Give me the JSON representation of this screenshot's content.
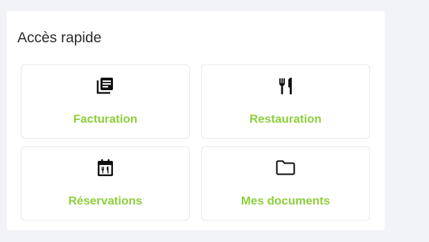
{
  "quick_access": {
    "title": "Accès rapide",
    "accent_color": "#8ccf3a",
    "tiles": [
      {
        "icon": "billing-stack-icon",
        "label": "Facturation"
      },
      {
        "icon": "fork-knife-icon",
        "label": "Restauration"
      },
      {
        "icon": "calendar-dining-icon",
        "label": "Réservations"
      },
      {
        "icon": "folder-icon",
        "label": "Mes documents"
      }
    ]
  }
}
